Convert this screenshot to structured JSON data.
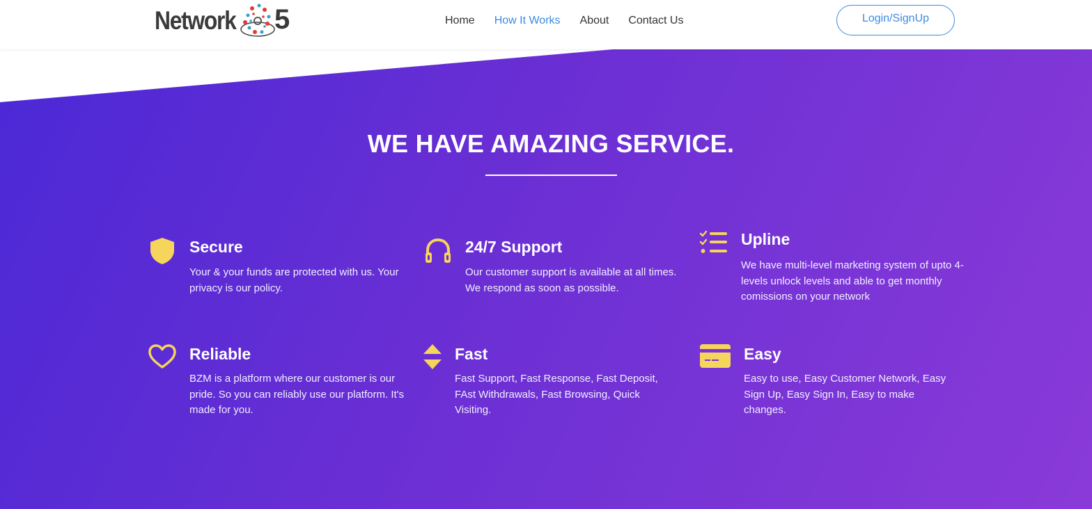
{
  "header": {
    "logo": {
      "word": "Network",
      "number": "5"
    },
    "nav": [
      {
        "label": "Home",
        "active": false
      },
      {
        "label": "How It Works",
        "active": true
      },
      {
        "label": "About",
        "active": false
      },
      {
        "label": "Contact Us",
        "active": false
      }
    ],
    "login_label": "Login/SignUp"
  },
  "section": {
    "title": "WE HAVE AMAZING SERVICE."
  },
  "features": [
    {
      "icon": "shield-icon",
      "title": "Secure",
      "text": "Your & your funds are protected with us. Your privacy is our policy."
    },
    {
      "icon": "headphones-icon",
      "title": "24/7 Support",
      "text": "Our customer support is available at all times. We respond as soon as possible."
    },
    {
      "icon": "checklist-icon",
      "title": "Upline",
      "text": "We have multi-level marketing system of upto 4-levels unlock levels and able to get monthly comissions on your network"
    },
    {
      "icon": "heart-icon",
      "title": "Reliable",
      "text": "BZM is a platform where our customer is our pride. So you can reliably use our platform. It's made for you."
    },
    {
      "icon": "sort-arrows-icon",
      "title": "Fast",
      "text": "Fast Support, Fast Response, Fast Deposit, FAst Withdrawals, Fast Browsing, Quick Visiting."
    },
    {
      "icon": "credit-card-icon",
      "title": "Easy",
      "text": "Easy to use, Easy Customer Network, Easy Sign Up, Easy Sign In, Easy to make changes."
    }
  ],
  "colors": {
    "gradient_start": "#4a28d6",
    "gradient_end": "#8a3ad8",
    "icon_yellow": "#f6d55c",
    "accent_blue": "#3b8be0"
  }
}
